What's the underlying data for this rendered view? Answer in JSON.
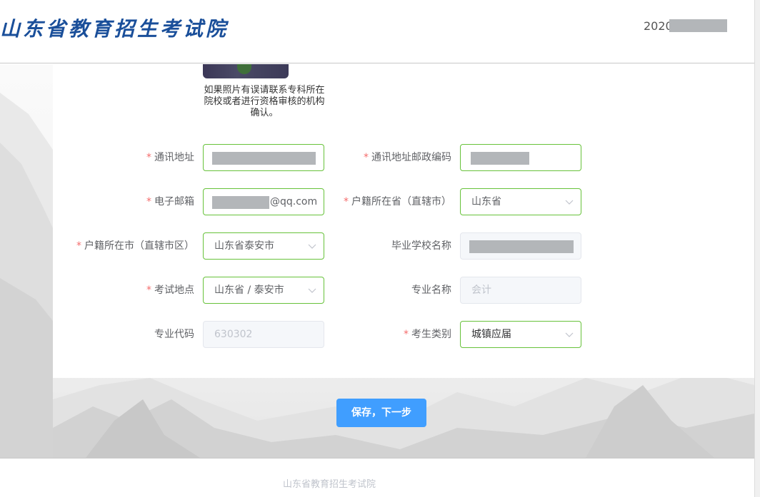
{
  "header": {
    "logo_text": "山东省教育招生考试院",
    "year_prefix": "2020"
  },
  "photo": {
    "note": "如果照片有误请联系专科所在院校或者进行资格审核的机构确认。"
  },
  "form": {
    "address": {
      "label": "通讯地址",
      "required": true,
      "value": ""
    },
    "postal_code": {
      "label": "通讯地址邮政编码",
      "required": true,
      "value": ""
    },
    "email": {
      "label": "电子邮箱",
      "required": true,
      "suffix": "@qq.com"
    },
    "household_province": {
      "label": "户籍所在省（直辖市）",
      "required": true,
      "value": "山东省"
    },
    "household_city": {
      "label": "户籍所在市（直辖市区）",
      "required": true,
      "value": "山东省泰安市"
    },
    "school_name": {
      "label": "毕业学校名称",
      "required": false,
      "value": ""
    },
    "exam_location": {
      "label": "考试地点",
      "required": true,
      "value": "山东省 / 泰安市"
    },
    "major_name": {
      "label": "专业名称",
      "required": false,
      "value": "会计"
    },
    "major_code": {
      "label": "专业代码",
      "required": false,
      "value": "630302"
    },
    "candidate_type": {
      "label": "考生类别",
      "required": true,
      "value": "城镇应届"
    },
    "required_mark": "*"
  },
  "actions": {
    "save_label": "保存，下一步"
  },
  "footer": {
    "text": "山东省教育招生考试院"
  },
  "colors": {
    "accent": "#409eff",
    "valid_border": "#67c23a",
    "required_star": "#f56c6c",
    "logo": "#1a4f9a"
  },
  "icons": {
    "select_arrow": "chevron-down-icon"
  }
}
